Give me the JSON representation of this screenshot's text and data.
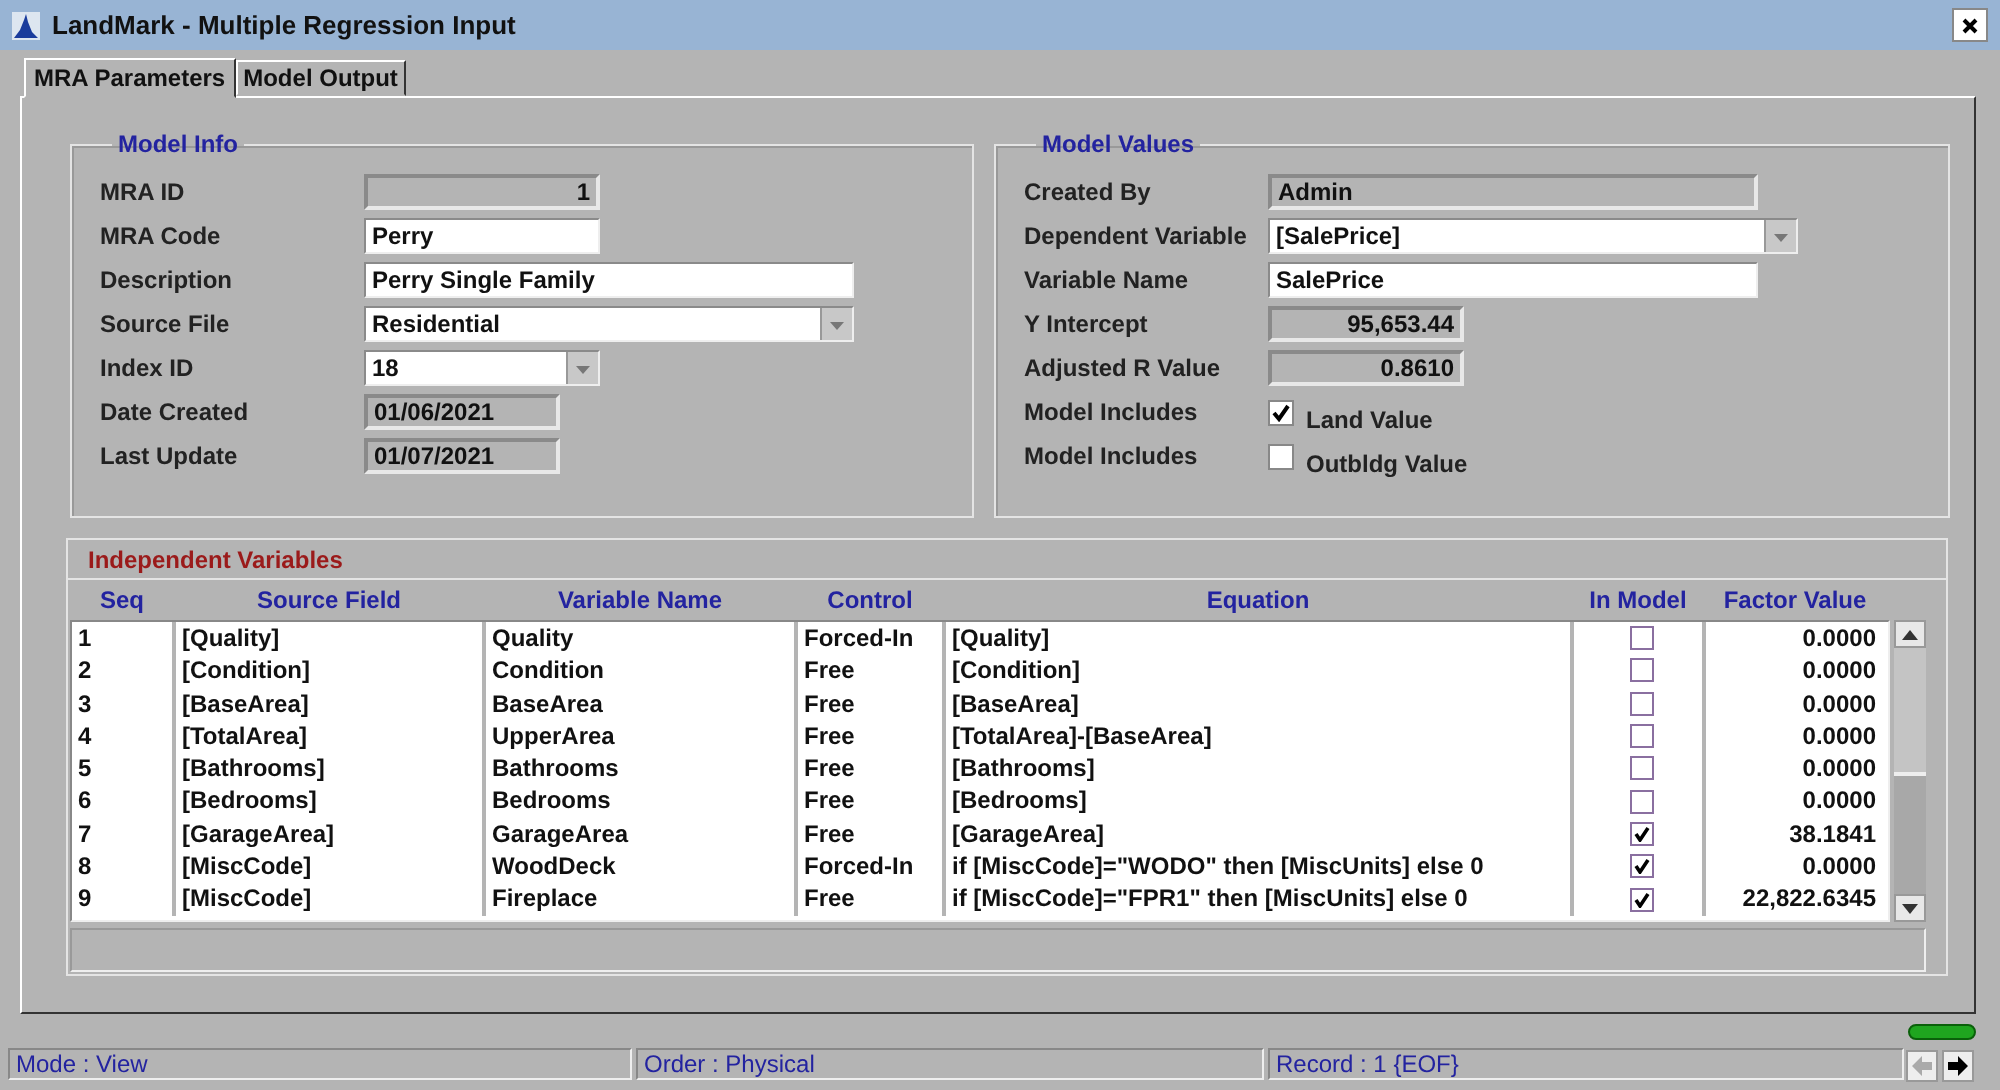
{
  "window": {
    "title": "LandMark - Multiple Regression Input"
  },
  "tabs": [
    {
      "label": "MRA Parameters",
      "selected": true
    },
    {
      "label": "Model Output",
      "selected": false
    }
  ],
  "model_info": {
    "title": "Model Info",
    "fields": [
      {
        "label": "MRA ID",
        "kind": "number",
        "value": "1"
      },
      {
        "label": "MRA Code",
        "kind": "text",
        "value": "Perry"
      },
      {
        "label": "Description",
        "kind": "text",
        "value": "Perry Single Family"
      },
      {
        "label": "Source File",
        "kind": "dropdown",
        "value": "Residential"
      },
      {
        "label": "Index ID",
        "kind": "dropdown",
        "value": "18"
      },
      {
        "label": "Date Created",
        "kind": "readonly",
        "value": "01/06/2021"
      },
      {
        "label": "Last Update",
        "kind": "readonly",
        "value": "01/07/2021"
      }
    ]
  },
  "model_values": {
    "title": "Model Values",
    "fields": [
      {
        "label": "Created By",
        "kind": "readonly",
        "value": "Admin"
      },
      {
        "label": "Dependent Variable",
        "kind": "dropdown",
        "value": "[SalePrice]"
      },
      {
        "label": "Variable Name",
        "kind": "text",
        "value": "SalePrice"
      },
      {
        "label": "Y Intercept",
        "kind": "number",
        "value": "95,653.44"
      },
      {
        "label": "Adjusted R Value",
        "kind": "number",
        "value": "0.8610"
      },
      {
        "label": "Model Includes",
        "kind": "checkbox",
        "value": "Land Value",
        "checked": true
      },
      {
        "label": "Model Includes",
        "kind": "checkbox",
        "value": "Outbldg Value",
        "checked": false
      }
    ]
  },
  "independent_variables": {
    "title": "Independent Variables",
    "columns": [
      "Seq",
      "Source Field",
      "Variable Name",
      "Control",
      "Equation",
      "In Model",
      "Factor Value"
    ],
    "rows": [
      {
        "seq": "1",
        "source_field": "[Quality]",
        "variable_name": "Quality",
        "control": "Forced-In",
        "equation": "[Quality]",
        "in_model": false,
        "factor_value": "0.0000"
      },
      {
        "seq": "2",
        "source_field": "[Condition]",
        "variable_name": "Condition",
        "control": "Free",
        "equation": "[Condition]",
        "in_model": false,
        "factor_value": "0.0000"
      },
      {
        "seq": "3",
        "source_field": "[BaseArea]",
        "variable_name": "BaseArea",
        "control": "Free",
        "equation": "[BaseArea]",
        "in_model": false,
        "factor_value": "0.0000"
      },
      {
        "seq": "4",
        "source_field": "[TotalArea]",
        "variable_name": "UpperArea",
        "control": "Free",
        "equation": "[TotalArea]-[BaseArea]",
        "in_model": false,
        "factor_value": "0.0000"
      },
      {
        "seq": "5",
        "source_field": "[Bathrooms]",
        "variable_name": "Bathrooms",
        "control": "Free",
        "equation": "[Bathrooms]",
        "in_model": false,
        "factor_value": "0.0000"
      },
      {
        "seq": "6",
        "source_field": "[Bedrooms]",
        "variable_name": "Bedrooms",
        "control": "Free",
        "equation": "[Bedrooms]",
        "in_model": false,
        "factor_value": "0.0000"
      },
      {
        "seq": "7",
        "source_field": "[GarageArea]",
        "variable_name": "GarageArea",
        "control": "Free",
        "equation": "[GarageArea]",
        "in_model": true,
        "factor_value": "38.1841"
      },
      {
        "seq": "8",
        "source_field": "[MiscCode]",
        "variable_name": "WoodDeck",
        "control": "Forced-In",
        "equation": "if [MiscCode]=\"WODO\" then [MiscUnits] else 0",
        "in_model": true,
        "factor_value": "0.0000"
      },
      {
        "seq": "9",
        "source_field": "[MiscCode]",
        "variable_name": "Fireplace",
        "control": "Free",
        "equation": "if [MiscCode]=\"FPR1\" then [MiscUnits] else 0",
        "in_model": true,
        "factor_value": "22,822.6345"
      }
    ]
  },
  "status_bar": [
    "Mode : View",
    "Order : Physical",
    "Record : 1 {EOF}"
  ],
  "navigation": [
    {
      "kind": "previous",
      "disabled": true
    },
    {
      "kind": "next",
      "disabled": false
    }
  ]
}
